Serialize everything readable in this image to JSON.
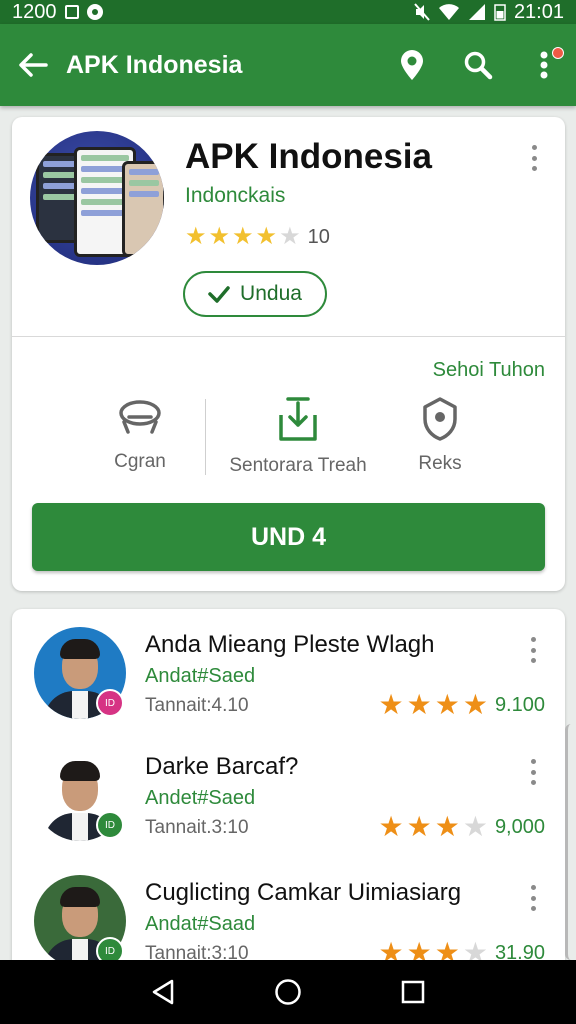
{
  "status_bar": {
    "time_left": "1200",
    "time_right": "21:01"
  },
  "app_bar": {
    "title": "APK Indonesia"
  },
  "app_card": {
    "name": "APK Indonesia",
    "developer": "Indonckais",
    "rating": 3.5,
    "rating_text": "10",
    "install_label": "Undua",
    "see_more": "Sehoi Tuhon",
    "stats": [
      {
        "icon": "controller-icon",
        "label": "Cgran"
      },
      {
        "icon": "download-box-icon",
        "label": "Sentorara Treah"
      },
      {
        "icon": "shield-icon",
        "label": "Reks"
      }
    ],
    "primary_button": "UND 4"
  },
  "reviews": [
    {
      "name": "Anda Mieang Pleste Wlagh",
      "subtitle": "Andat#Saed",
      "date": "Tannait:4.10",
      "stars": 4,
      "score": "9.100",
      "avatar_bg": "#1f7bc4",
      "badge_color": "#d63384",
      "badge_text": "ID"
    },
    {
      "name": "Darke Barcaf?",
      "subtitle": "Andet#Saed",
      "date": "Tannait.3:10",
      "stars": 3,
      "score": "9,000",
      "avatar_bg": "#ffffff",
      "badge_color": "#2e8a3b",
      "badge_text": "ID"
    },
    {
      "name": "Cuglicting Camkar Uimiasiarg",
      "subtitle": "Andat#Saad",
      "date": "Tannait:3:10",
      "stars": 3,
      "score": "31.90",
      "avatar_bg": "#3a6a3a",
      "badge_color": "#2e8a3b",
      "badge_text": "ID"
    }
  ],
  "colors": {
    "brand_green": "#2e8a3b",
    "dark_green": "#1f6e2a",
    "star_gold": "#f2c02e",
    "star_orange": "#ee8f17"
  }
}
